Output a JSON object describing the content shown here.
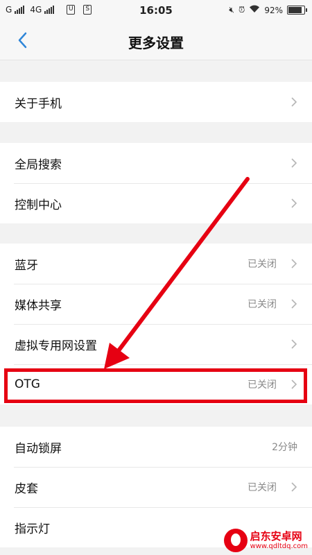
{
  "status_bar": {
    "carrier1": "G",
    "carrier2": "4G",
    "time": "16:05",
    "battery": "92%",
    "battery_level": 0.92
  },
  "navbar": {
    "title": "更多设置"
  },
  "sections": [
    {
      "items": [
        {
          "label": "关于手机",
          "value": ""
        }
      ]
    },
    {
      "items": [
        {
          "label": "全局搜索",
          "value": ""
        },
        {
          "label": "控制中心",
          "value": ""
        }
      ]
    },
    {
      "items": [
        {
          "label": "蓝牙",
          "value": "已关闭"
        },
        {
          "label": "媒体共享",
          "value": "已关闭"
        },
        {
          "label": "虚拟专用网设置",
          "value": ""
        },
        {
          "label": "OTG",
          "value": "已关闭"
        }
      ]
    },
    {
      "items": [
        {
          "label": "自动锁屏",
          "value": "2分钟"
        },
        {
          "label": "皮套",
          "value": "已关闭"
        },
        {
          "label": "指示灯",
          "value": ""
        }
      ]
    }
  ],
  "watermark": {
    "name": "启东安卓网",
    "url": "www.qdltdq.com"
  },
  "colors": {
    "annotation": "#e60012",
    "accent": "#2f86d8"
  }
}
